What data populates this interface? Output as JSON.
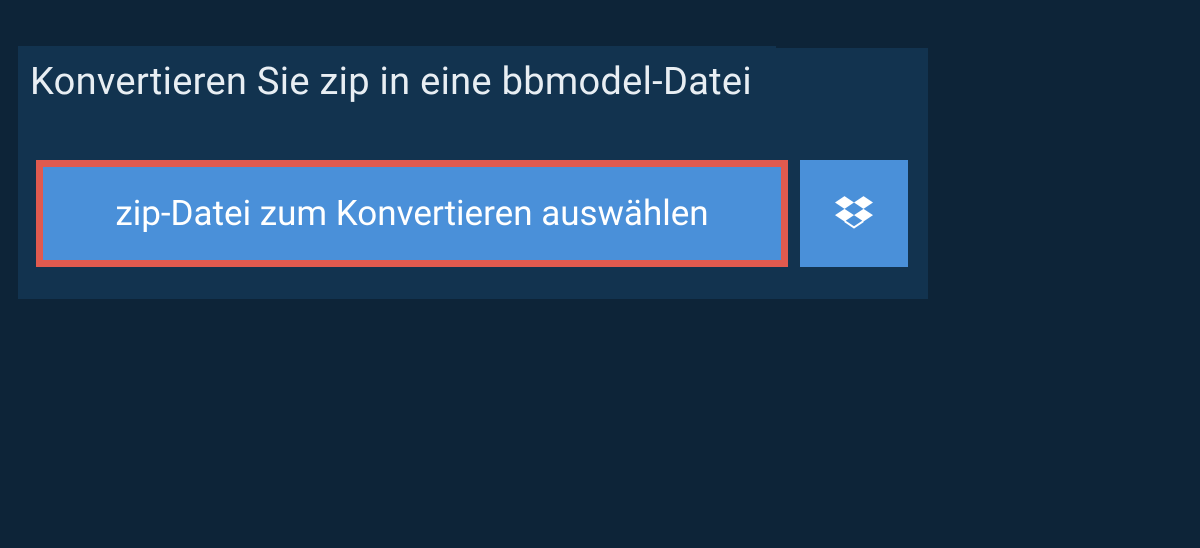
{
  "heading": "Konvertieren Sie zip in eine bbmodel-Datei",
  "buttons": {
    "select_file_label": "zip-Datei zum Konvertieren auswählen"
  },
  "colors": {
    "page_bg": "#0d2438",
    "panel_bg": "#12334f",
    "button_bg": "#4a90d9",
    "button_border": "#e05a4f",
    "text": "#e8eef3"
  }
}
